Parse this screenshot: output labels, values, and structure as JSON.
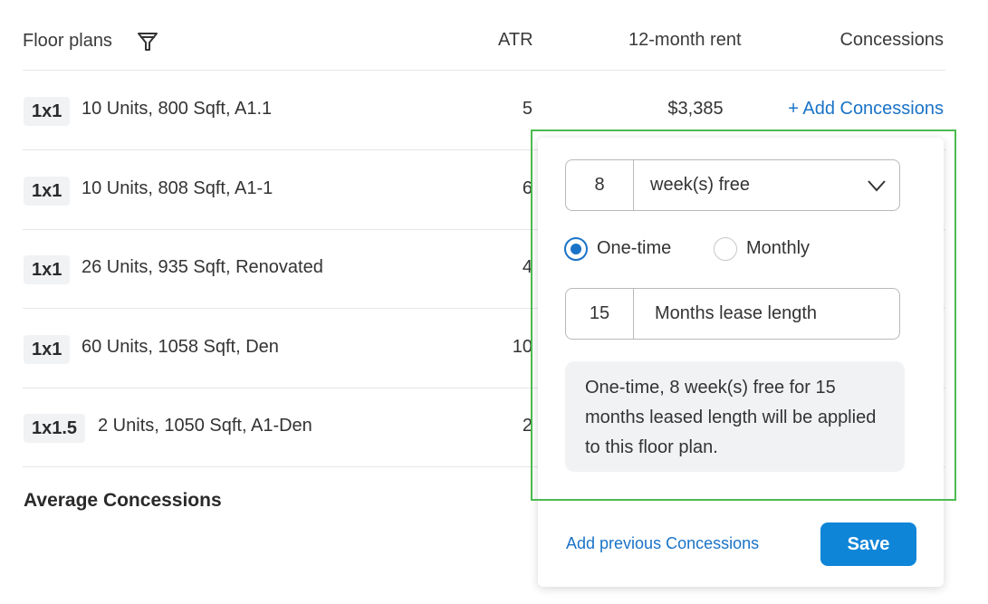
{
  "header": {
    "floor_plans": "Floor plans",
    "atr": "ATR",
    "rent": "12-month rent",
    "concessions": "Concessions"
  },
  "rows": [
    {
      "badge": "1x1",
      "desc": "10 Units, 800 Sqft, A1.1",
      "atr": "5",
      "rent": "$3,385",
      "action": "+ Add Concessions"
    },
    {
      "badge": "1x1",
      "desc": "10 Units, 808 Sqft, A1-1",
      "atr": "6"
    },
    {
      "badge": "1x1",
      "desc": "26 Units, 935 Sqft, Renovated",
      "atr": "4"
    },
    {
      "badge": "1x1",
      "desc": "60 Units, 1058 Sqft, Den",
      "atr": "10"
    },
    {
      "badge": "1x1.5",
      "desc": "2 Units, 1050 Sqft, A1-Den",
      "atr": "2"
    }
  ],
  "average_label": "Average Concessions",
  "popover": {
    "free_amount": "8",
    "free_unit": "week(s) free",
    "radio_onetime": "One-time",
    "radio_monthly": "Monthly",
    "selected": "One-time",
    "lease_months": "15",
    "lease_label": "Months lease length",
    "summary": "One-time, 8 week(s) free for 15 months leased length will be applied to this floor plan.",
    "prev_link": "Add previous Concessions",
    "save": "Save"
  },
  "colors": {
    "accent": "#1a73c7",
    "save_button": "#0f85d8",
    "highlight": "#4cba4f"
  }
}
